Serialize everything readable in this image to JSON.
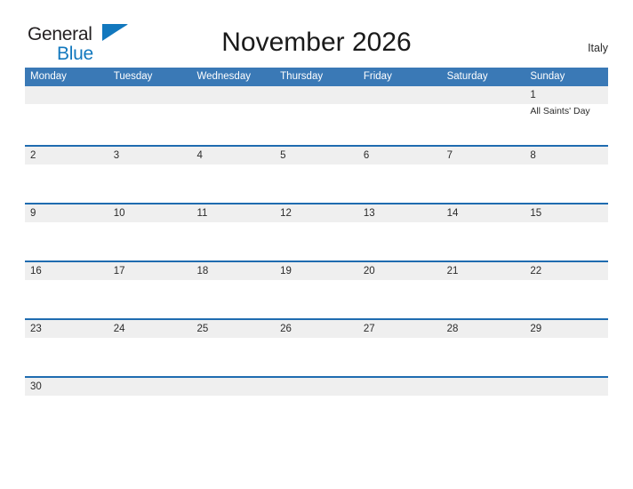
{
  "brand": {
    "word1": "General",
    "word2": "Blue",
    "flag_icon": "triangle-flag-icon",
    "color_dark": "#231f20",
    "color_blue": "#1278be"
  },
  "header": {
    "title": "November 2026",
    "country": "Italy"
  },
  "theme": {
    "header_blue": "#3a79b6",
    "rule_blue": "#1f6cb0",
    "date_band": "#efefef"
  },
  "calendar": {
    "weekdays": [
      "Monday",
      "Tuesday",
      "Wednesday",
      "Thursday",
      "Friday",
      "Saturday",
      "Sunday"
    ],
    "weeks": [
      {
        "days": [
          {
            "date": "",
            "events": []
          },
          {
            "date": "",
            "events": []
          },
          {
            "date": "",
            "events": []
          },
          {
            "date": "",
            "events": []
          },
          {
            "date": "",
            "events": []
          },
          {
            "date": "",
            "events": []
          },
          {
            "date": "1",
            "events": [
              "All Saints' Day"
            ]
          }
        ]
      },
      {
        "days": [
          {
            "date": "2",
            "events": []
          },
          {
            "date": "3",
            "events": []
          },
          {
            "date": "4",
            "events": []
          },
          {
            "date": "5",
            "events": []
          },
          {
            "date": "6",
            "events": []
          },
          {
            "date": "7",
            "events": []
          },
          {
            "date": "8",
            "events": []
          }
        ]
      },
      {
        "days": [
          {
            "date": "9",
            "events": []
          },
          {
            "date": "10",
            "events": []
          },
          {
            "date": "11",
            "events": []
          },
          {
            "date": "12",
            "events": []
          },
          {
            "date": "13",
            "events": []
          },
          {
            "date": "14",
            "events": []
          },
          {
            "date": "15",
            "events": []
          }
        ]
      },
      {
        "days": [
          {
            "date": "16",
            "events": []
          },
          {
            "date": "17",
            "events": []
          },
          {
            "date": "18",
            "events": []
          },
          {
            "date": "19",
            "events": []
          },
          {
            "date": "20",
            "events": []
          },
          {
            "date": "21",
            "events": []
          },
          {
            "date": "22",
            "events": []
          }
        ]
      },
      {
        "days": [
          {
            "date": "23",
            "events": []
          },
          {
            "date": "24",
            "events": []
          },
          {
            "date": "25",
            "events": []
          },
          {
            "date": "26",
            "events": []
          },
          {
            "date": "27",
            "events": []
          },
          {
            "date": "28",
            "events": []
          },
          {
            "date": "29",
            "events": []
          }
        ]
      },
      {
        "days": [
          {
            "date": "30",
            "events": []
          },
          {
            "date": "",
            "events": []
          },
          {
            "date": "",
            "events": []
          },
          {
            "date": "",
            "events": []
          },
          {
            "date": "",
            "events": []
          },
          {
            "date": "",
            "events": []
          },
          {
            "date": "",
            "events": []
          }
        ]
      }
    ]
  }
}
